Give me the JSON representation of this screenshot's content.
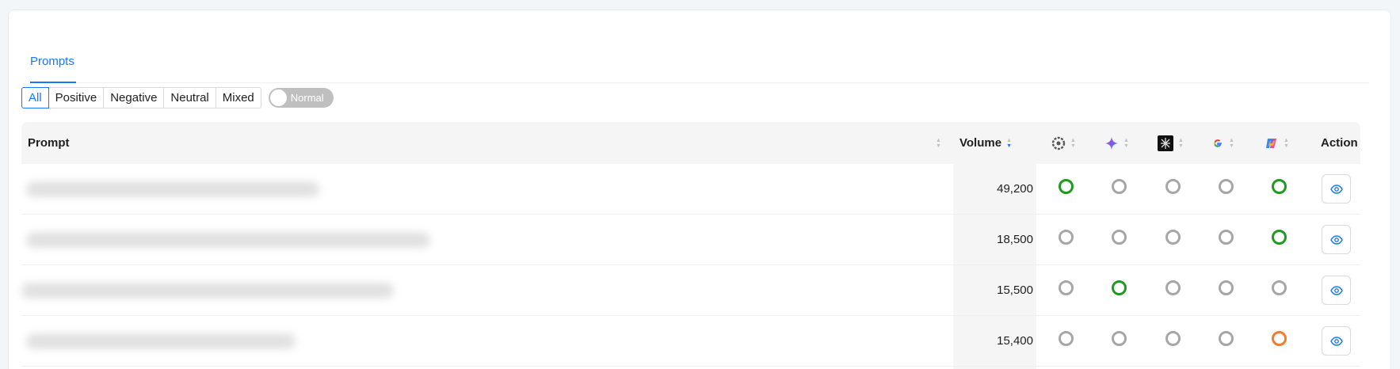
{
  "tabs": [
    {
      "label": "Prompts",
      "active": true
    }
  ],
  "filters": {
    "segments": [
      "All",
      "Positive",
      "Negative",
      "Neutral",
      "Mixed"
    ],
    "active": "All",
    "toggle_label": "Normal"
  },
  "table": {
    "columns": {
      "prompt": "Prompt",
      "volume": "Volume",
      "engines": [
        "chatgpt-icon",
        "gemini-icon",
        "perplexity-icon",
        "google-icon",
        "copilot-icon"
      ],
      "action": "Action"
    },
    "rows": [
      {
        "prompt_hidden": true,
        "volume": "49,200",
        "status": [
          "green",
          "gray",
          "gray",
          "gray",
          "green"
        ]
      },
      {
        "prompt_hidden": true,
        "volume": "18,500",
        "status": [
          "gray",
          "gray",
          "gray",
          "gray",
          "green"
        ]
      },
      {
        "prompt_hidden": true,
        "volume": "15,500",
        "status": [
          "gray",
          "green",
          "gray",
          "gray",
          "gray"
        ]
      },
      {
        "prompt_hidden": true,
        "volume": "15,400",
        "status": [
          "gray",
          "gray",
          "gray",
          "gray",
          "orange"
        ]
      }
    ]
  },
  "colors": {
    "accent": "#1677ff",
    "status_green": "#1e9a1e",
    "status_gray": "#a6a6a6",
    "status_orange": "#f57c2a"
  }
}
